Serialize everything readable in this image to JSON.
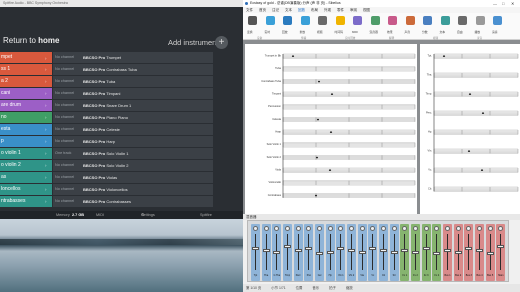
{
  "sampler": {
    "window_title": "Spitfire Audio - BBC Symphony Orchestra",
    "back_label_prefix": "Return to ",
    "back_label_bold": "home",
    "add_instrument_label": "Add instrument",
    "add_icon_glyph": "+",
    "rows": [
      {
        "name": "mpet",
        "color": "#d9593d",
        "channel": "No channel",
        "patch_bold": "BBCSO Pro",
        "patch_rest": " Trumpet"
      },
      {
        "name": "ss 1",
        "color": "#d9593d",
        "channel": "No channel",
        "patch_bold": "BBCSO Pro",
        "patch_rest": " Contrabass Tuba"
      },
      {
        "name": "a 2",
        "color": "#d9593d",
        "channel": "No channel",
        "patch_bold": "BBCSO Pro",
        "patch_rest": " Tuba"
      },
      {
        "name": "cani",
        "color": "#9c5fc6",
        "channel": "No channel",
        "patch_bold": "BBCSO Pro",
        "patch_rest": " Timpani"
      },
      {
        "name": "are drum",
        "color": "#9c5fc6",
        "channel": "No channel",
        "patch_bold": "BBCSO Pro",
        "patch_rest": " Snare Drum 1"
      },
      {
        "name": "no",
        "color": "#3f9e66",
        "channel": "No channel",
        "patch_bold": "BBCSO Pro",
        "patch_rest": " Piano Piano"
      },
      {
        "name": "esta",
        "color": "#3a8fc8",
        "channel": "No channel",
        "patch_bold": "BBCSO Pro",
        "patch_rest": " Celeste"
      },
      {
        "name": "p",
        "color": "#3a8fc8",
        "channel": "No channel",
        "patch_bold": "BBCSO Pro",
        "patch_rest": " Harp"
      },
      {
        "name": "o violin 1",
        "color": "#2f9488",
        "channel": "One track",
        "patch_bold": "BBCSO Pro",
        "patch_rest": " Solo Violin 1"
      },
      {
        "name": "o violin 2",
        "color": "#2f9488",
        "channel": "No channel",
        "patch_bold": "BBCSO Pro",
        "patch_rest": " Solo Violin 2"
      },
      {
        "name": "as",
        "color": "#2f9488",
        "channel": "No channel",
        "patch_bold": "BBCSO Pro",
        "patch_rest": " Violas"
      },
      {
        "name": "loncellos",
        "color": "#2f9488",
        "channel": "No channel",
        "patch_bold": "BBCSO Pro",
        "patch_rest": " Violoncellos"
      },
      {
        "name": "ntrabasses",
        "color": "#2f9488",
        "channel": "No channel",
        "patch_bold": "BBCSO Pro",
        "patch_rest": " Contrabasses"
      }
    ],
    "row_go_glyph": "›",
    "status": {
      "memory_label": "Memory",
      "memory_value": "2.7 GB",
      "midi": "MIDI",
      "settings_label": "Settings",
      "brand": "Spitfire"
    }
  },
  "editor": {
    "window_title": "Ecstasy of gold - 总谱(DB演奏版) 分声 (声 非 页) - Sibelius",
    "window_controls": [
      "—",
      "□",
      "✕"
    ],
    "menu": [
      "文件",
      "首页",
      "注记",
      "文本",
      "回放",
      "布局",
      "外观",
      "零件",
      "审阅",
      "视图"
    ],
    "active_menu": "回放",
    "ribbon_labels": [
      "变换",
      "实时",
      "回放",
      "重放",
      "视频",
      "时间码",
      "MIDI",
      "混音器",
      "效果",
      "声音",
      "分数",
      "文本",
      "自由",
      "播放",
      "演奏"
    ],
    "ribbon_groups": [
      "设备",
      "传输",
      "实时回放",
      "解释",
      "视频",
      "录音"
    ],
    "staff_labels_page1": [
      "Trumpet in Bb",
      "Tuba",
      "Contrabass Tuba",
      "Timpani",
      "Percussion",
      "Celesta",
      "Harp",
      "Solo Violin 1",
      "Solo Violin 2",
      "Viola",
      "Violoncello",
      "Contrabass"
    ],
    "staff_labels_page2": [
      "Tpt.",
      "Tba.",
      "Timp.",
      "Perc.",
      "Hp.",
      "Vln.",
      "Vc.",
      "Cb."
    ],
    "mixer_title": "混音器",
    "mixer_strips": [
      {
        "label": "Tpt",
        "color": "#8fb4d8",
        "level": 0.6
      },
      {
        "label": "Tba",
        "color": "#8fb4d8",
        "level": 0.55
      },
      {
        "label": "C.Tba",
        "color": "#8fb4d8",
        "level": 0.5
      },
      {
        "label": "Timp",
        "color": "#8fb4d8",
        "level": 0.65
      },
      {
        "label": "Perc",
        "color": "#8fb4d8",
        "level": 0.55
      },
      {
        "label": "Pno",
        "color": "#8fb4d8",
        "level": 0.6
      },
      {
        "label": "Cel",
        "color": "#8fb4d8",
        "level": 0.45
      },
      {
        "label": "Hp",
        "color": "#8fb4d8",
        "level": 0.5
      },
      {
        "label": "Vln 1",
        "color": "#8fb4d8",
        "level": 0.6
      },
      {
        "label": "Vln 2",
        "color": "#8fb4d8",
        "level": 0.55
      },
      {
        "label": "Vla",
        "color": "#8fb4d8",
        "level": 0.5
      },
      {
        "label": "Vc",
        "color": "#8fb4d8",
        "level": 0.6
      },
      {
        "label": "Cb",
        "color": "#8fb4d8",
        "level": 0.55
      },
      {
        "label": "Str",
        "color": "#8fb4d8",
        "level": 0.5
      },
      {
        "label": "Fx 1",
        "color": "#86b46f",
        "level": 0.55
      },
      {
        "label": "Fx 2",
        "color": "#86b46f",
        "level": 0.5
      },
      {
        "label": "Fx 3",
        "color": "#86b46f",
        "level": 0.6
      },
      {
        "label": "Fx 4",
        "color": "#86b46f",
        "level": 0.45
      },
      {
        "label": "Bus 1",
        "color": "#d98a8a",
        "level": 0.55
      },
      {
        "label": "Bus 2",
        "color": "#d98a8a",
        "level": 0.5
      },
      {
        "label": "Bus 3",
        "color": "#d98a8a",
        "level": 0.6
      },
      {
        "label": "Bus 4",
        "color": "#d98a8a",
        "level": 0.55
      },
      {
        "label": "Bus 5",
        "color": "#d98a8a",
        "level": 0.45
      },
      {
        "label": "Main",
        "color": "#d98a8a",
        "level": 0.65
      }
    ],
    "status_bar": [
      "第 1/10 页",
      "小节 1/71",
      "位置",
      "音乐",
      "拍子",
      "缩放"
    ]
  }
}
